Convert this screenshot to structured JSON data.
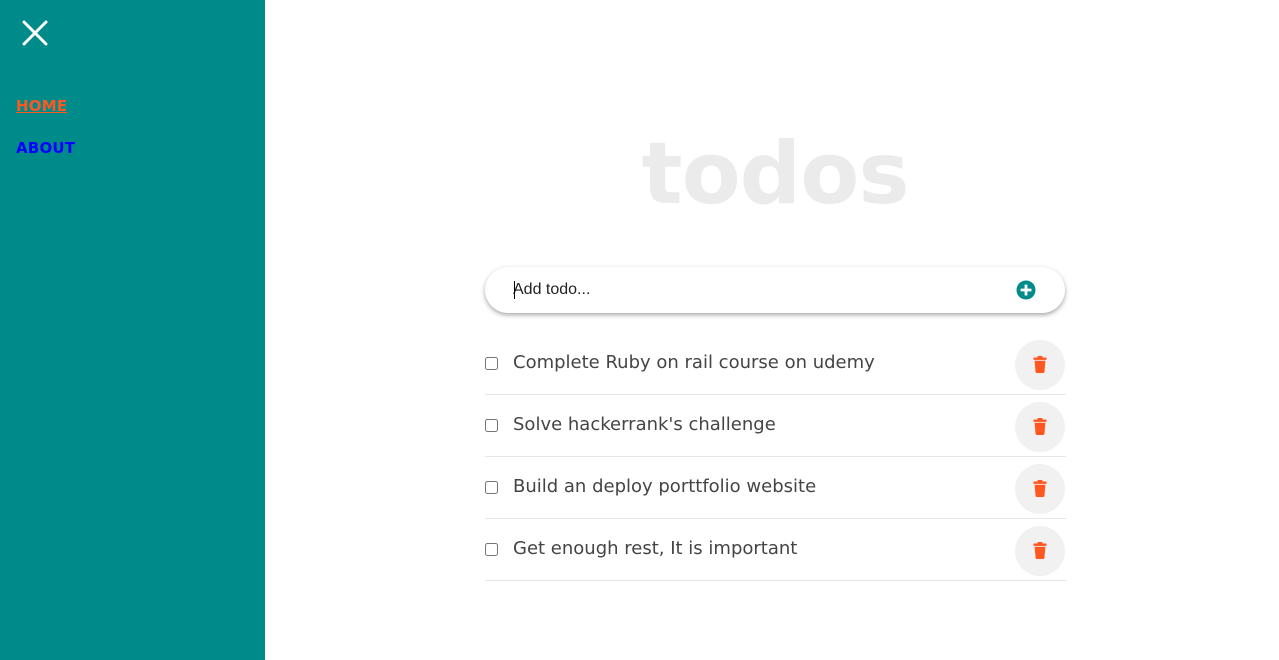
{
  "sidebar": {
    "close_icon": "close-icon",
    "nav": [
      {
        "label": "HOME",
        "active": true
      },
      {
        "label": "ABOUT",
        "active": false
      }
    ],
    "background": "#008b8b"
  },
  "main": {
    "title": "todos",
    "add": {
      "placeholder": "Add todo...",
      "button_icon": "plus-circle-icon",
      "accent": "#008b8b"
    },
    "todos": [
      {
        "text": "Complete Ruby on rail course on udemy",
        "checked": false
      },
      {
        "text": "Solve hackerrank's challenge",
        "checked": false
      },
      {
        "text": "Build an deploy porttfolio website",
        "checked": false
      },
      {
        "text": "Get enough rest, It is important",
        "checked": false
      }
    ],
    "delete_icon": "trash-icon",
    "delete_color": "#ff5722"
  }
}
